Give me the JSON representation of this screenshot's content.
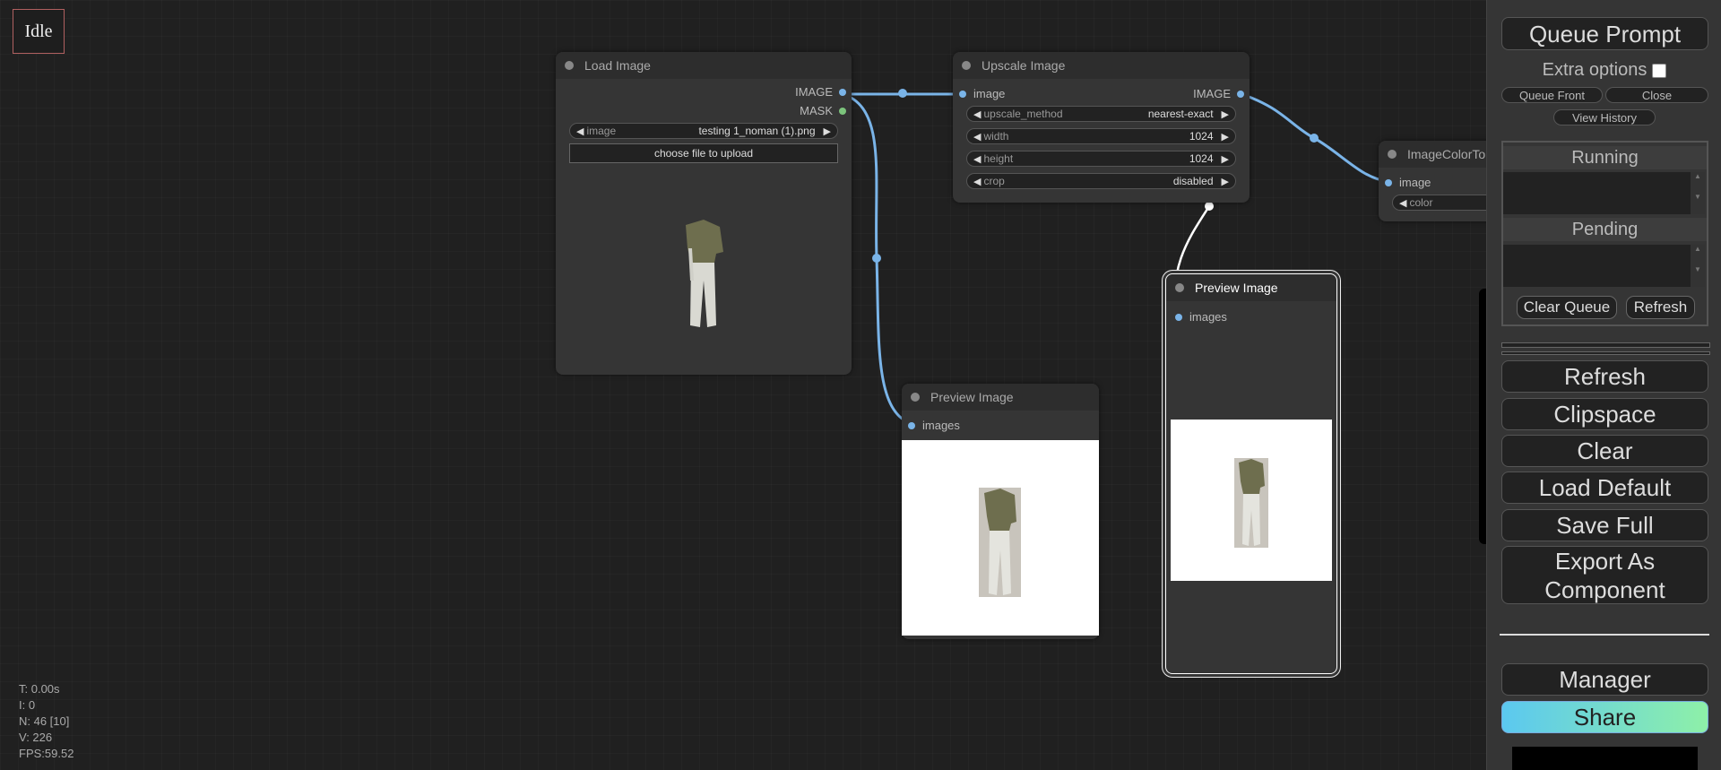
{
  "status": "Idle",
  "stats": [
    "T: 0.00s",
    "I: 0",
    "N: 46 [10]",
    "V: 226",
    "FPS:59.52"
  ],
  "nodes": {
    "load_image": {
      "title": "Load Image",
      "outputs": [
        "IMAGE",
        "MASK"
      ],
      "widget_image_label": "image",
      "widget_image_value": "testing 1_noman (1).png",
      "upload_label": "choose file to upload"
    },
    "upscale_image": {
      "title": "Upscale Image",
      "input": "image",
      "output": "IMAGE",
      "widgets": [
        {
          "label": "upscale_method",
          "value": "nearest-exact"
        },
        {
          "label": "width",
          "value": "1024"
        },
        {
          "label": "height",
          "value": "1024"
        },
        {
          "label": "crop",
          "value": "disabled"
        }
      ]
    },
    "preview_a": {
      "title": "Preview Image",
      "input": "images"
    },
    "preview_b": {
      "title": "Preview Image",
      "input": "images"
    },
    "image_color": {
      "title": "ImageColorTo",
      "input": "image",
      "widget_label": "color"
    }
  },
  "side": {
    "queue_prompt": "Queue Prompt",
    "extra_options": "Extra options",
    "queue_front": "Queue Front",
    "close": "Close",
    "view_history": "View History",
    "running": "Running",
    "pending": "Pending",
    "clear_queue": "Clear Queue",
    "refresh_small": "Refresh",
    "buttons": [
      "Refresh",
      "Clipspace",
      "Clear",
      "Load Default",
      "Save Full"
    ],
    "export_line1": "Export As",
    "export_line2": "Component",
    "manager": "Manager",
    "share": "Share"
  },
  "colors": {
    "link": "#7ab4e8",
    "accent_share_start": "#5bc8f0",
    "accent_share_end": "#8ef0a8"
  }
}
